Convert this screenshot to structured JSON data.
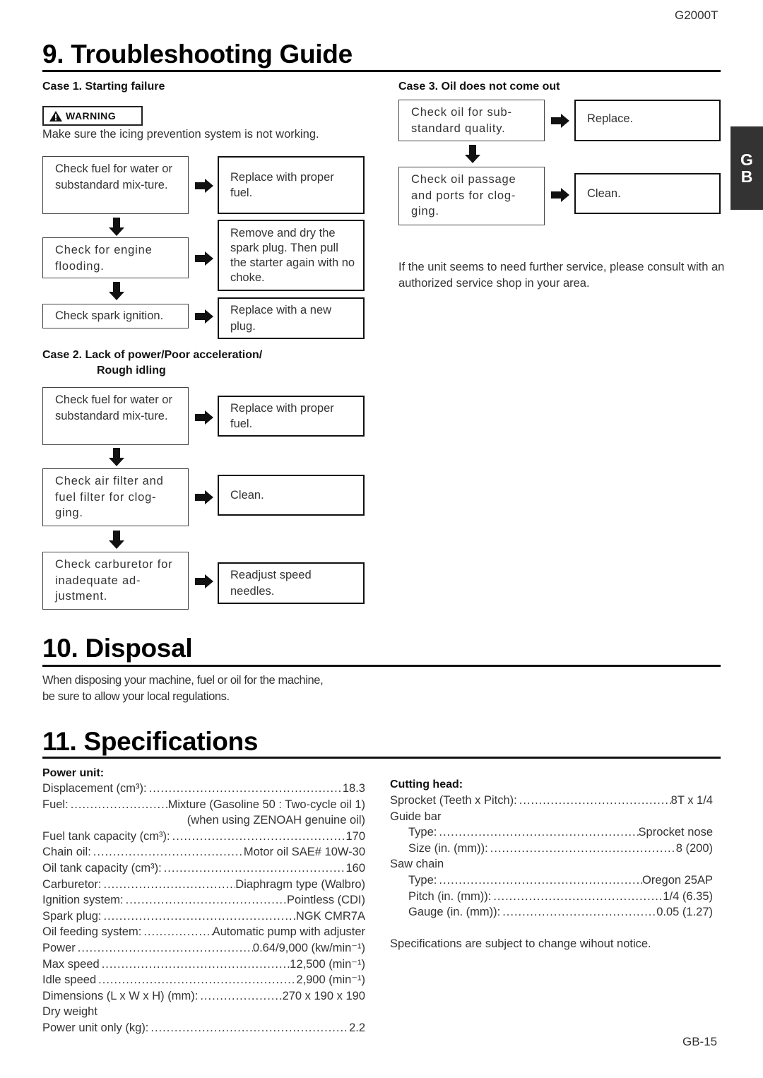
{
  "header": {
    "model": "G2000T"
  },
  "language_tab": {
    "line1": "G",
    "line2": "B"
  },
  "troubleshooting": {
    "title": "9. Troubleshooting Guide",
    "case1": {
      "title": "Case 1.  Starting failure",
      "warning_label": "WARNING",
      "warning_text": "Make sure the icing prevention system is not working.",
      "steps": [
        {
          "check": "Check fuel for water or substandard mix-ture.",
          "action": "Replace with proper fuel."
        },
        {
          "check": "Check for engine flooding.",
          "action": "Remove and dry the spark plug. Then pull the starter again with no choke."
        },
        {
          "check": "Check spark ignition.",
          "action": "Replace with a new plug."
        }
      ]
    },
    "case2": {
      "title_line1": "Case 2.  Lack of power/Poor acceleration/",
      "title_line2": "Rough idling",
      "steps": [
        {
          "check": "Check fuel for water or substandard mix-ture.",
          "action": "Replace with proper fuel."
        },
        {
          "check": "Check air filter and fuel filter for clog-ging.",
          "action": "Clean."
        },
        {
          "check": "Check carburetor for inadequate ad-justment.",
          "action": "Readjust speed needles."
        }
      ]
    },
    "case3": {
      "title": "Case 3.  Oil does not come out",
      "steps": [
        {
          "check": "Check oil for sub-standard quality.",
          "action": "Replace."
        },
        {
          "check": "Check oil passage and ports for clog-ging.",
          "action": "Clean."
        }
      ],
      "note": "If the unit seems to need further service, please consult with an authorized service shop in your area."
    }
  },
  "disposal": {
    "title": "10. Disposal",
    "text_line1": "When disposing your machine, fuel or oil for the machine,",
    "text_line2": "be sure to allow your local regulations."
  },
  "specifications": {
    "title": "11. Specifications",
    "power_unit": {
      "heading": "Power unit:",
      "rows": [
        {
          "label": "Displacement (cm³):",
          "value": "18.3"
        },
        {
          "label": "Fuel:",
          "value": "Mixture (Gasoline 50 : Two-cycle oil 1)"
        },
        {
          "label": "",
          "value": "(when using  ZENOAH genuine oil)"
        },
        {
          "label": "Fuel tank capacity (cm³):",
          "value": "170"
        },
        {
          "label": "Chain oil:",
          "value": "Motor oil SAE# 10W-30"
        },
        {
          "label": "Oil tank capacity (cm³):",
          "value": "160"
        },
        {
          "label": "Carburetor:",
          "value": "Diaphragm type (Walbro)"
        },
        {
          "label": "Ignition system:",
          "value": "Pointless (CDI)"
        },
        {
          "label": "Spark plug:",
          "value": "NGK CMR7A"
        },
        {
          "label": "Oil feeding system:",
          "value": "Automatic pump with adjuster"
        },
        {
          "label": "Power",
          "value": "0.64/9,000 (kw/min⁻¹)"
        },
        {
          "label": "Max speed",
          "value": "12,500 (min⁻¹)"
        },
        {
          "label": "Idle speed",
          "value": "2,900 (min⁻¹)"
        },
        {
          "label": "Dimensions (L x W x H) (mm):",
          "value": "270 x 190 x 190"
        },
        {
          "label": "Dry weight",
          "value": ""
        },
        {
          "label": "Power unit only (kg):",
          "value": "2.2"
        }
      ]
    },
    "cutting_head": {
      "heading": "Cutting head:",
      "rows": [
        {
          "label": "Sprocket (Teeth x Pitch):",
          "value": "8T x 1/4"
        },
        {
          "label": "Guide bar",
          "value": ""
        },
        {
          "label": "Type:",
          "value": "Sprocket nose"
        },
        {
          "label": "Size (in. (mm)):",
          "value": "8 (200)"
        },
        {
          "label": "Saw chain",
          "value": ""
        },
        {
          "label": "Type:",
          "value": "Oregon 25AP"
        },
        {
          "label": "Pitch (in. (mm)):",
          "value": "1/4 (6.35)"
        },
        {
          "label": "Gauge (in. (mm)):",
          "value": "0.05 (1.27)"
        }
      ]
    },
    "notice": "Specifications are subject to change wihout notice."
  },
  "footer": {
    "page_number": "GB-15"
  }
}
